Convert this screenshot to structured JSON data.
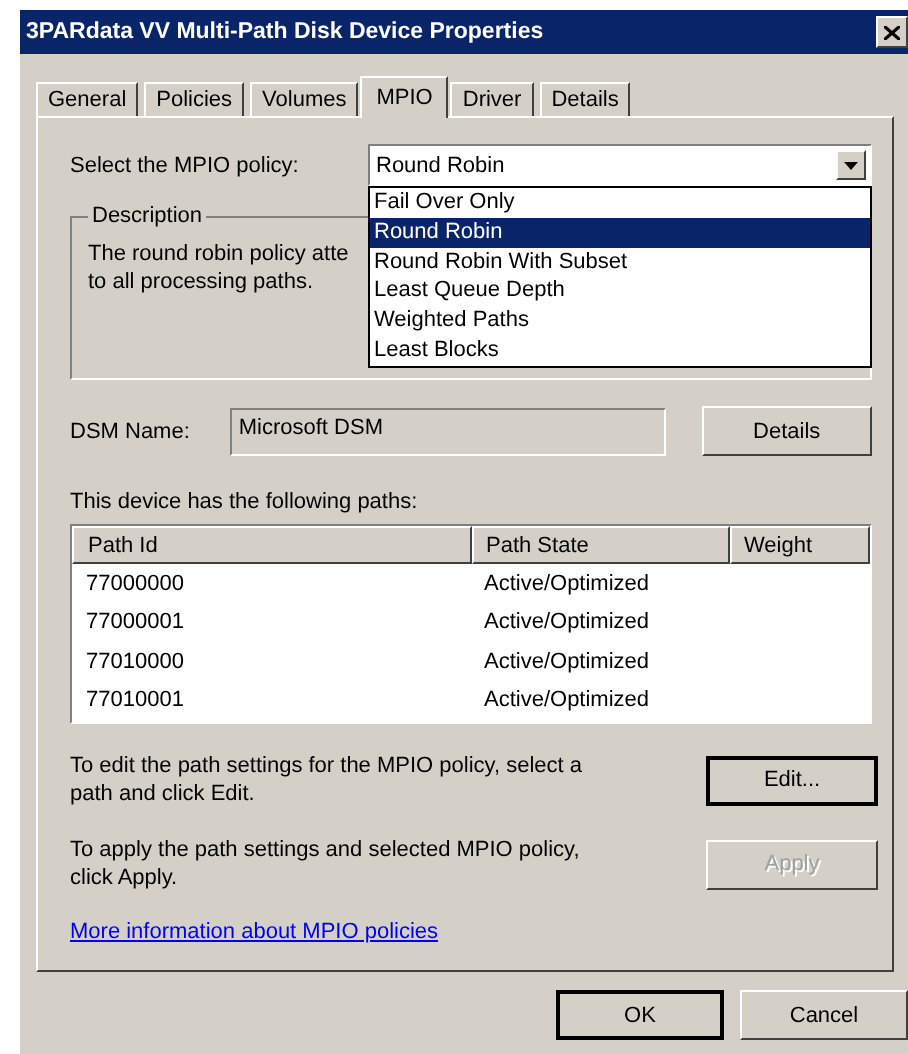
{
  "window": {
    "title": "3PARdata VV  Multi-Path Disk Device Properties"
  },
  "tabs": [
    {
      "label": "General",
      "selected": false
    },
    {
      "label": "Policies",
      "selected": false
    },
    {
      "label": "Volumes",
      "selected": false
    },
    {
      "label": "MPIO",
      "selected": true
    },
    {
      "label": "Driver",
      "selected": false
    },
    {
      "label": "Details",
      "selected": false
    }
  ],
  "policy": {
    "label": "Select the MPIO policy:",
    "value": "Round Robin",
    "expanded": true,
    "options": [
      {
        "label": "Fail Over Only",
        "selected": false
      },
      {
        "label": "Round Robin",
        "selected": true
      },
      {
        "label": "Round Robin With Subset",
        "selected": false
      },
      {
        "label": "Least Queue Depth",
        "selected": false
      },
      {
        "label": "Weighted Paths",
        "selected": false
      },
      {
        "label": "Least Blocks",
        "selected": false
      }
    ]
  },
  "description": {
    "title": "Description",
    "lines": [
      "The round robin policy atte",
      "to all processing paths."
    ]
  },
  "dsm": {
    "label": "DSM Name:",
    "value": "Microsoft DSM",
    "button": "Details"
  },
  "paths": {
    "caption": "This device has the following paths:",
    "columns": [
      "Path Id",
      "Path State",
      "Weight"
    ],
    "rows": [
      {
        "path_id": "77000000",
        "path_state": "Active/Optimized"
      },
      {
        "path_id": "77000001",
        "path_state": "Active/Optimized"
      },
      {
        "path_id": "77010000",
        "path_state": "Active/Optimized"
      },
      {
        "path_id": "77010001",
        "path_state": "Active/Optimized"
      }
    ]
  },
  "actions": [
    {
      "lines": [
        "To edit the path settings for the MPIO policy, select a",
        "path and click Edit."
      ],
      "button": "Edit...",
      "default": true,
      "disabled": false
    },
    {
      "lines": [
        "To apply the path settings and selected MPIO policy,",
        "click Apply."
      ],
      "button": "Apply",
      "default": false,
      "disabled": true
    }
  ],
  "link": "More information about MPIO policies",
  "buttons": [
    {
      "label": "OK",
      "default": true
    },
    {
      "label": "Cancel",
      "default": false
    }
  ]
}
